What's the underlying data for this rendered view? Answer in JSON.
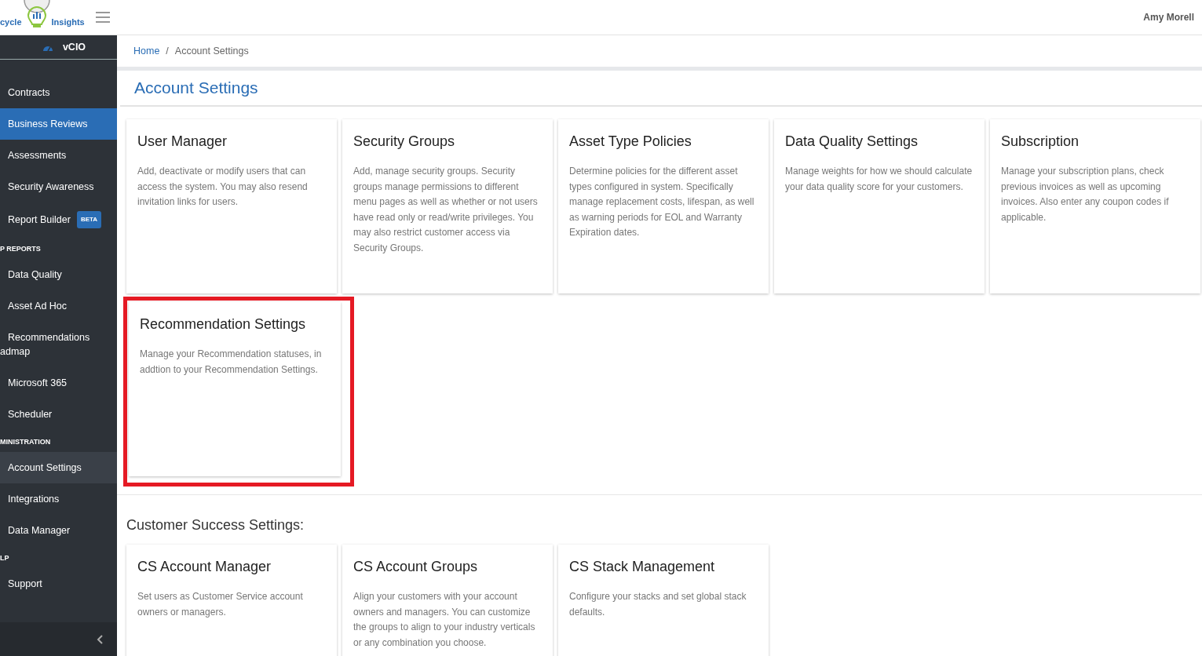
{
  "logo": {
    "left_text": "cycle",
    "right_text": "Insights"
  },
  "user": {
    "name": "Amy Morell"
  },
  "sidebar": {
    "module": "vCIO",
    "items": [
      {
        "kind": "item",
        "label": "Contracts",
        "selected": false,
        "current": false
      },
      {
        "kind": "item",
        "label": "Business Reviews",
        "selected": true,
        "current": false
      },
      {
        "kind": "item",
        "label": "Assessments",
        "selected": false,
        "current": false
      },
      {
        "kind": "item",
        "label": "Security Awareness",
        "selected": false,
        "current": false
      },
      {
        "kind": "item",
        "label": "Report Builder",
        "badge": "BETA",
        "selected": false,
        "current": false
      },
      {
        "kind": "header",
        "label": "P REPORTS"
      },
      {
        "kind": "item",
        "label": "Data Quality",
        "selected": false,
        "current": false
      },
      {
        "kind": "item",
        "label": "Asset Ad Hoc",
        "selected": false,
        "current": false
      },
      {
        "kind": "item",
        "label": "Recommendations admap",
        "selected": false,
        "current": false
      },
      {
        "kind": "item",
        "label": "Microsoft 365",
        "selected": false,
        "current": false
      },
      {
        "kind": "item",
        "label": "Scheduler",
        "selected": false,
        "current": false
      },
      {
        "kind": "header",
        "label": "MINISTRATION"
      },
      {
        "kind": "item",
        "label": "Account Settings",
        "selected": false,
        "current": true
      },
      {
        "kind": "item",
        "label": "Integrations",
        "selected": false,
        "current": false
      },
      {
        "kind": "item",
        "label": "Data Manager",
        "selected": false,
        "current": false
      },
      {
        "kind": "header",
        "label": "LP"
      },
      {
        "kind": "item",
        "label": "Support",
        "selected": false,
        "current": false
      }
    ]
  },
  "breadcrumb": [
    {
      "label": "Home",
      "link": true
    },
    {
      "label": "Account Settings",
      "link": false
    }
  ],
  "breadcrumb_separator": "/",
  "page_title": "Account Settings",
  "sections": [
    {
      "cards": [
        {
          "title": "User Manager",
          "description": "Add, deactivate or modify users that can access the system. You may also resend invitation links for users.",
          "highlighted": false
        },
        {
          "title": "Security Groups",
          "description": "Add, manage security groups. Security groups manage permissions to different menu pages as well as whether or not users have read only or read/write privileges. You may also restrict customer access via Security Groups.",
          "highlighted": false
        },
        {
          "title": "Asset Type Policies",
          "description": "Determine policies for the different asset types configured in system. Specifically manage replacement costs, lifespan, as well as warning periods for EOL and Warranty Expiration dates.",
          "highlighted": false
        },
        {
          "title": "Data Quality Settings",
          "description": "Manage weights for how we should calculate your data quality score for your customers.",
          "highlighted": false
        },
        {
          "title": "Subscription",
          "description": "Manage your subscription plans, check previous invoices as well as upcoming invoices. Also enter any coupon codes if applicable.",
          "highlighted": false
        },
        {
          "title": "Recommendation Settings",
          "description": "Manage your Recommendation statuses, in addtion to your Recommendation Settings.",
          "highlighted": true
        }
      ]
    },
    {
      "heading": "Customer Success Settings:",
      "cards": [
        {
          "title": "CS Account Manager",
          "description": "Set users as Customer Service account owners or managers.",
          "highlighted": false
        },
        {
          "title": "CS Account Groups",
          "description": "Align your customers with your account owners and managers. You can customize the groups to align to your industry verticals or any combination you choose.",
          "highlighted": false
        },
        {
          "title": "CS Stack Management",
          "description": "Configure your stacks and set global stack defaults.",
          "highlighted": false
        }
      ]
    }
  ]
}
